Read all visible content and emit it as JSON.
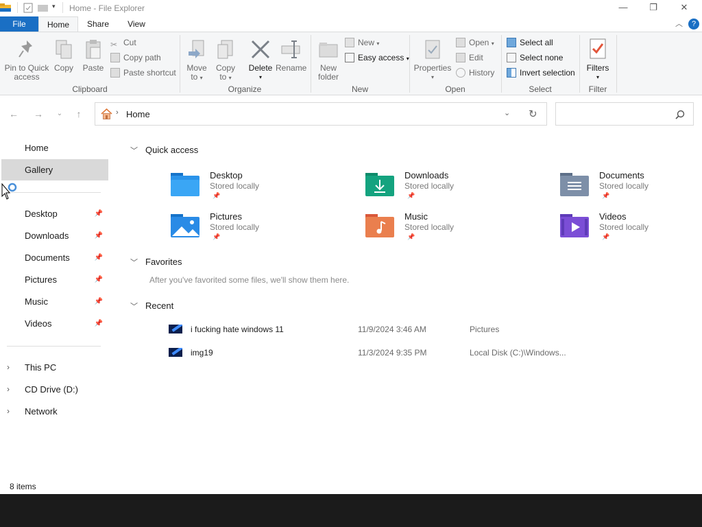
{
  "window": {
    "title": "Home - File Explorer"
  },
  "ribbon_tabs": [
    "File",
    "Home",
    "Share",
    "View"
  ],
  "ribbon": {
    "clipboard": {
      "label": "Clipboard",
      "pin_line1": "Pin to Quick",
      "pin_line2": "access",
      "copy": "Copy",
      "paste": "Paste",
      "cut": "Cut",
      "copy_path": "Copy path",
      "paste_shortcut": "Paste shortcut"
    },
    "organize": {
      "label": "Organize",
      "move_to_1": "Move",
      "move_to_2": "to",
      "copy_to_1": "Copy",
      "copy_to_2": "to",
      "delete": "Delete",
      "rename": "Rename"
    },
    "new": {
      "label": "New",
      "new_folder_1": "New",
      "new_folder_2": "folder",
      "new_item": "New",
      "easy_access": "Easy access"
    },
    "open": {
      "label": "Open",
      "properties": "Properties",
      "open": "Open",
      "edit": "Edit",
      "history": "History"
    },
    "select": {
      "label": "Select",
      "select_all": "Select all",
      "select_none": "Select none",
      "invert_selection": "Invert selection"
    },
    "filter": {
      "label": "Filter",
      "filters": "Filters"
    }
  },
  "address": {
    "location": "Home",
    "search_placeholder": ""
  },
  "nav": {
    "home": "Home",
    "gallery": "Gallery",
    "pinned": [
      "Desktop",
      "Downloads",
      "Documents",
      "Pictures",
      "Music",
      "Videos"
    ],
    "drives": [
      "This PC",
      "CD Drive (D:)",
      "Network"
    ]
  },
  "content": {
    "quick_access_title": "Quick access",
    "tiles": [
      {
        "name": "Desktop",
        "sub": "Stored locally",
        "color": "#1e88e5"
      },
      {
        "name": "Downloads",
        "sub": "Stored locally",
        "color": "#14a37f"
      },
      {
        "name": "Documents",
        "sub": "Stored locally",
        "color": "#6b7f99"
      },
      {
        "name": "Pictures",
        "sub": "Stored locally",
        "color": "#2a8be6"
      },
      {
        "name": "Music",
        "sub": "Stored locally",
        "color": "#e8704a"
      },
      {
        "name": "Videos",
        "sub": "Stored locally",
        "color": "#7b4ed6"
      }
    ],
    "favorites_title": "Favorites",
    "favorites_empty": "After you've favorited some files, we'll show them here.",
    "recent_title": "Recent",
    "recent": [
      {
        "name": "i fucking hate windows 11",
        "date": "11/9/2024 3:46 AM",
        "location": "Pictures"
      },
      {
        "name": "img19",
        "date": "11/3/2024 9:35 PM",
        "location": "Local Disk (C:)\\Windows..."
      }
    ]
  },
  "status": {
    "items": "8 items"
  },
  "colors": {
    "accent": "#1a6fc4",
    "selection": "#d9d9d9"
  }
}
